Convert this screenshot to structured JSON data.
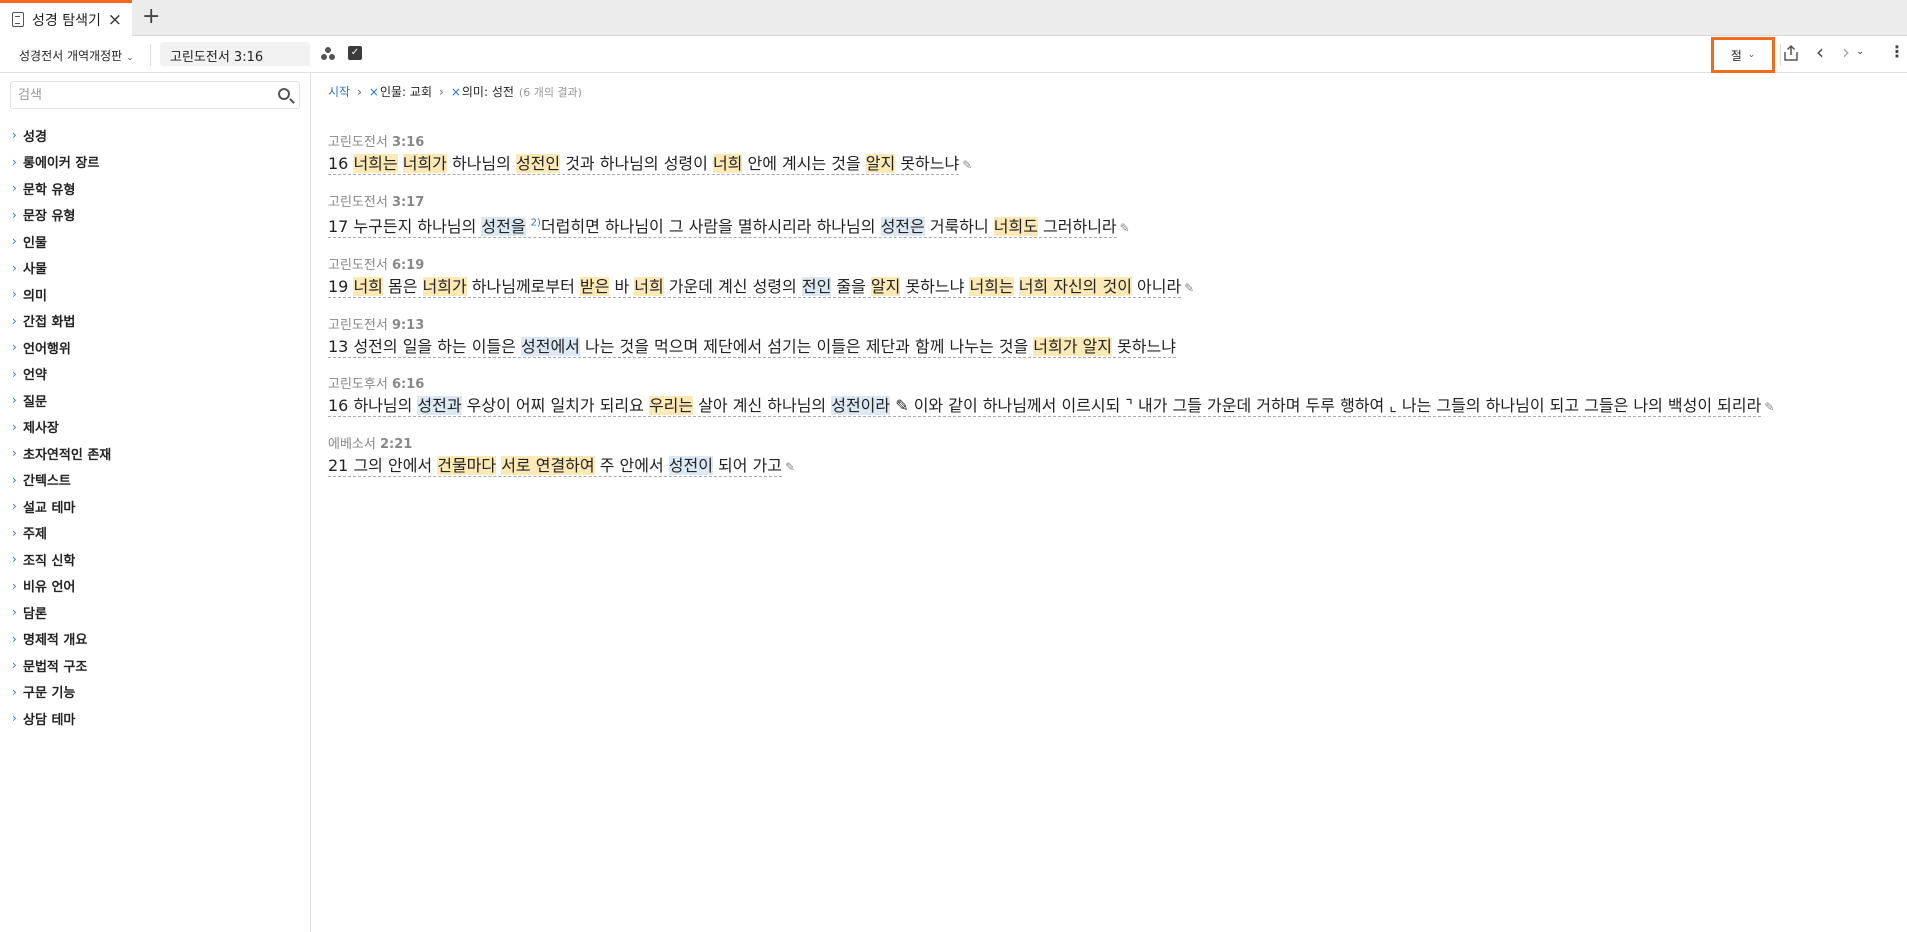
{
  "tab": {
    "title": "성경 탐색기"
  },
  "toolbar": {
    "version": "성경전서 개역개정판",
    "reference": "고린도전서 3:16",
    "unit": "절"
  },
  "sidebar": {
    "search_placeholder": "검색",
    "items": [
      "성경",
      "롱에이커 장르",
      "문학 유형",
      "문장 유형",
      "인물",
      "사물",
      "의미",
      "간접 화법",
      "언어행위",
      "언약",
      "질문",
      "제사장",
      "초자연적인 존재",
      "간텍스트",
      "설교 테마",
      "주제",
      "조직 신학",
      "비유 언어",
      "담론",
      "명제적 개요",
      "문법적 구조",
      "구문 기능",
      "상담 테마"
    ]
  },
  "breadcrumb": {
    "start": "시작",
    "filter1": "인물: 교회",
    "filter2": "의미: 성전",
    "count": "(6 개의 결과)"
  },
  "results": [
    {
      "book": "고린도전서",
      "ch": "3:16",
      "segments": [
        {
          "t": "16 "
        },
        {
          "t": "너희는",
          "h": "y"
        },
        {
          "t": " "
        },
        {
          "t": "너희가",
          "h": "y"
        },
        {
          "t": " 하나님의 "
        },
        {
          "t": "성전인",
          "h": "y"
        },
        {
          "t": " 것과 하나님의 성령이 "
        },
        {
          "t": "너희",
          "h": "y"
        },
        {
          "t": " 안에 계시는 것을 "
        },
        {
          "t": "알지",
          "h": "y"
        },
        {
          "t": " 못하느냐"
        }
      ]
    },
    {
      "book": "고린도전서",
      "ch": "3:17",
      "segments": [
        {
          "t": "17 누구든지 하나님의 "
        },
        {
          "t": "성전을",
          "h": "b"
        },
        {
          "t": " "
        },
        {
          "t": "2)",
          "h": "fn"
        },
        {
          "t": "더럽히면 하나님이 그 사람을 멸하시리라 하나님의 "
        },
        {
          "t": "성전은",
          "h": "b"
        },
        {
          "t": " 거룩하니 "
        },
        {
          "t": "너희도",
          "h": "y"
        },
        {
          "t": " 그러하니라"
        }
      ]
    },
    {
      "book": "고린도전서",
      "ch": "6:19",
      "segments": [
        {
          "t": "19 "
        },
        {
          "t": "너희",
          "h": "y"
        },
        {
          "t": " 몸은 "
        },
        {
          "t": "너희가",
          "h": "y"
        },
        {
          "t": " 하나님께로부터 "
        },
        {
          "t": "받은",
          "h": "y"
        },
        {
          "t": " 바 "
        },
        {
          "t": "너희",
          "h": "y"
        },
        {
          "t": " 가운데 계신 성령의 "
        },
        {
          "t": "전인",
          "h": "b"
        },
        {
          "t": " 줄을 "
        },
        {
          "t": "알지",
          "h": "y"
        },
        {
          "t": " 못하느냐 "
        },
        {
          "t": "너희는",
          "h": "y"
        },
        {
          "t": " "
        },
        {
          "t": "너희 자신의 것이",
          "h": "y"
        },
        {
          "t": " 아니라"
        }
      ]
    },
    {
      "book": "고린도전서",
      "ch": "9:13",
      "segments": [
        {
          "t": "13 성전의 일을 하는 이들은 "
        },
        {
          "t": "성전에서",
          "h": "b"
        },
        {
          "t": " 나는 것을 먹으며 제단에서 섬기는 이들은 제단과 함께 나누는 것을 "
        },
        {
          "t": "너희가 알지",
          "h": "y"
        },
        {
          "t": " 못하느냐"
        }
      ]
    },
    {
      "book": "고린도후서",
      "ch": "6:16",
      "segments": [
        {
          "t": "16 하나님의 "
        },
        {
          "t": "성전과",
          "h": "b"
        },
        {
          "t": " 우상이 어찌 일치가 되리요 "
        },
        {
          "t": "우리는",
          "h": "y"
        },
        {
          "t": " 살아 계신 하나님의 "
        },
        {
          "t": "성전이라",
          "h": "b"
        },
        {
          "t": " ✎ 이와 같이 하나님께서 이르시되 ⌝ 내가 그들 가운데 거하며 두루 행하여 ⌞ 나는 그들의 하나님이 되고 그들은 나의 백성이 되리라"
        }
      ]
    },
    {
      "book": "에베소서",
      "ch": "2:21",
      "segments": [
        {
          "t": "21 그의 안에서 "
        },
        {
          "t": "건물마다",
          "h": "y"
        },
        {
          "t": " "
        },
        {
          "t": "서로 연결하여",
          "h": "y"
        },
        {
          "t": " 주 안에서 "
        },
        {
          "t": "성전이",
          "h": "b"
        },
        {
          "t": " 되어 가고"
        }
      ]
    }
  ],
  "colors": {
    "accent": "#f26a1b",
    "link": "#2a77c9",
    "highlight_yellow": "#fde9b5",
    "highlight_blue": "#dce9f5"
  }
}
